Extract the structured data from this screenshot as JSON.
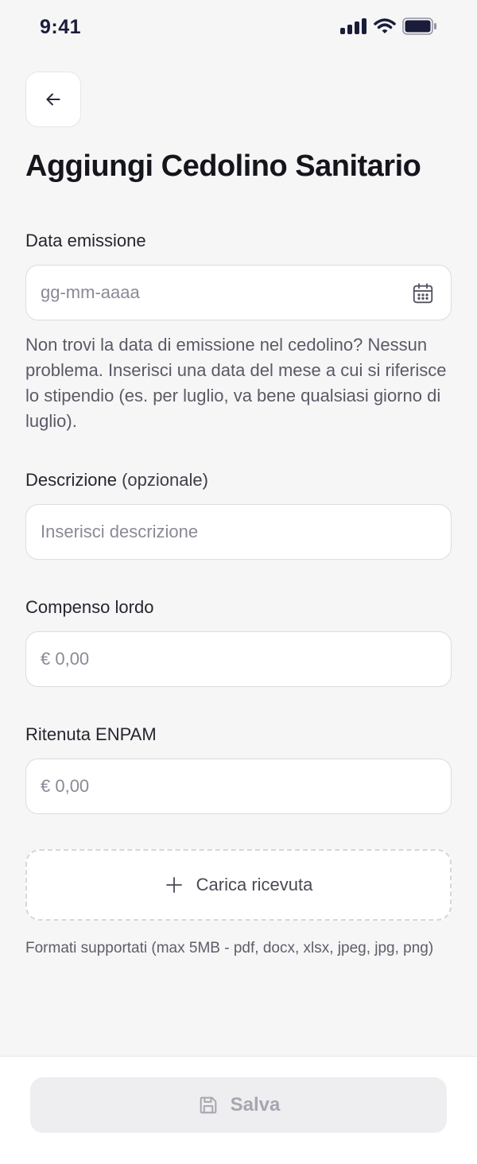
{
  "status_bar": {
    "time": "9:41"
  },
  "header": {
    "title": "Aggiungi Cedolino Sanitario"
  },
  "form": {
    "date": {
      "label": "Data emissione",
      "placeholder": "gg-mm-aaaa",
      "value": "",
      "help": "Non trovi la data di emissione nel cedolino? Nessun problema. Inserisci una data del mese a cui si riferisce lo stipendio (es. per luglio, va bene qualsiasi giorno di luglio)."
    },
    "description": {
      "label": "Descrizione",
      "label_optional": "(opzionale)",
      "placeholder": "Inserisci descrizione",
      "value": ""
    },
    "gross": {
      "label": "Compenso lordo",
      "placeholder": "€ 0,00",
      "value": ""
    },
    "enpam": {
      "label": "Ritenuta ENPAM",
      "placeholder": "€ 0,00",
      "value": ""
    },
    "upload": {
      "label": "Carica ricevuta",
      "formats": "Formati supportati (max 5MB - pdf, docx, xlsx, jpeg, jpg, png)"
    }
  },
  "footer": {
    "save_label": "Salva"
  },
  "icons": {
    "back": "arrow-left-icon",
    "calendar": "calendar-icon",
    "upload": "plus-icon",
    "save": "floppy-disk-icon"
  },
  "colors": {
    "background": "#f6f6f7",
    "text_primary": "#15151c",
    "placeholder": "#8a8a96",
    "status_dark": "#1a1c3a",
    "disabled_button": "#eeeef1",
    "disabled_text": "#a6a6b0"
  }
}
